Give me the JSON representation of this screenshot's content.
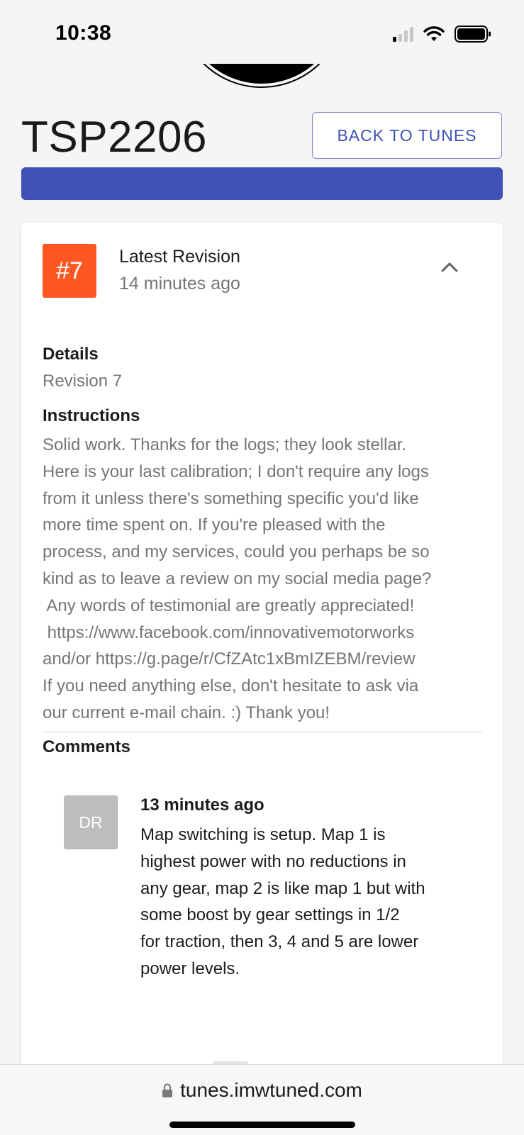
{
  "status_bar": {
    "time": "10:38",
    "signal_icon": "cellular-signal-icon",
    "wifi_icon": "wifi-icon",
    "battery_icon": "battery-icon"
  },
  "header": {
    "title": "TSP2206",
    "back_label": "BACK TO TUNES",
    "progress_percent": 100,
    "accent_color": "#3f51b5"
  },
  "revision": {
    "number": "#7",
    "badge_color": "#ff5722",
    "title": "Latest Revision",
    "time": "14 minutes ago",
    "toggle_icon": "chevron-up-icon",
    "details_label": "Details",
    "details_value": "Revision 7",
    "instructions_label": "Instructions",
    "instructions_lines": [
      "Solid work. Thanks for the logs; they look stellar.",
      "Here is your last calibration; I don't require any logs",
      "from it unless there's something specific you'd like",
      "more time spent on. If you're pleased with the",
      "process, and my services, could you perhaps be so",
      "kind as to leave a review on my social media page?",
      " Any words of testimonial are greatly appreciated!",
      " https://www.facebook.com/innovativemotorworks",
      "and/or https://g.page/r/CfZAtc1xBmIZEBM/review",
      "If you need anything else, don't hesitate to ask via",
      "our current e-mail chain. :) Thank you!"
    ],
    "comments_label": "Comments",
    "comments": [
      {
        "avatar": "DR",
        "time": "13 minutes ago",
        "lines": [
          "Map switching is setup. Map 1 is",
          "highest power with no reductions in",
          "any gear, map 2 is like map 1 but with",
          "some boost by gear settings in 1/2",
          "for traction, then 3, 4 and 5 are lower",
          "power levels."
        ]
      }
    ]
  },
  "browser": {
    "lock_icon": "lock-icon",
    "url": "tunes.imwtuned.com"
  }
}
